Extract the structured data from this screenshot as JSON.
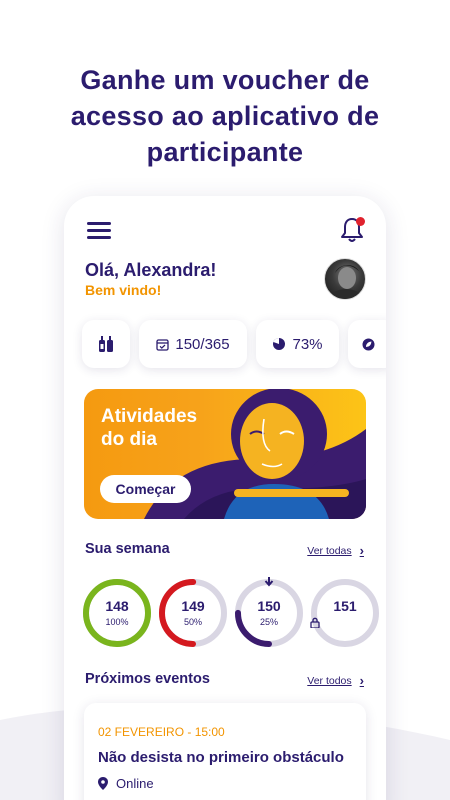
{
  "headline": {
    "line1": "Ganhe um voucher de",
    "line2": "acesso ao aplicativo de",
    "line3": "participante"
  },
  "header": {
    "menu_icon": "hamburger-menu-icon",
    "notification_icon": "bell-icon",
    "has_notification": true
  },
  "greeting": {
    "hello": "Olá, Alexandra!",
    "welcome": "Bem vindo!"
  },
  "stats": [
    {
      "icon": "bottles-icon",
      "value": ""
    },
    {
      "icon": "calendar-icon",
      "value": "150/365"
    },
    {
      "icon": "pie-icon",
      "value": "73%"
    },
    {
      "icon": "leaf-icon",
      "value": ""
    }
  ],
  "banner": {
    "title": "Atividades do dia",
    "button": "Começar"
  },
  "week": {
    "title": "Sua semana",
    "see_all": "Ver todas",
    "days": [
      {
        "day": "148",
        "label": "100%",
        "progress": 1.0,
        "color": "#7ab51d",
        "locked": false,
        "current": false
      },
      {
        "day": "149",
        "label": "50%",
        "progress": 0.5,
        "color": "#d4191f",
        "locked": false,
        "current": false
      },
      {
        "day": "150",
        "label": "25%",
        "progress": 0.25,
        "color": "#3b1c6e",
        "locked": false,
        "current": true
      },
      {
        "day": "151",
        "label": "",
        "progress": 0,
        "color": "#3b1c6e",
        "locked": true,
        "current": false
      }
    ]
  },
  "events": {
    "title": "Próximos eventos",
    "see_all": "Ver todos",
    "items": [
      {
        "date": "02 FEVEREIRO - 15:00",
        "title": "Não desista no primeiro obstáculo",
        "location": "Online"
      }
    ]
  },
  "colors": {
    "primary": "#2b1c6e",
    "accent": "#f29400",
    "ring_track": "#d9d6e3",
    "notification": "#e0222e"
  }
}
